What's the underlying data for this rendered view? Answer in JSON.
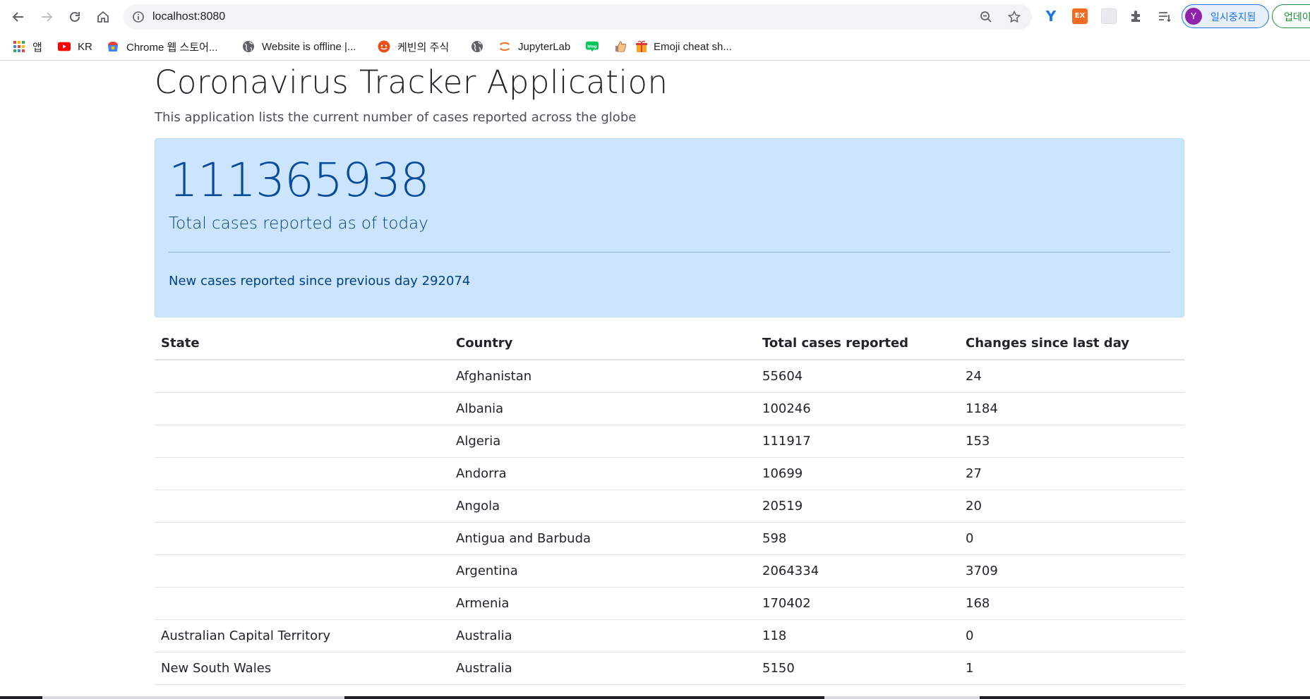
{
  "browser": {
    "url": "localhost:8080",
    "profile_initial": "Y",
    "profile_label": "일시중지됨",
    "update_label": "업데이",
    "extensions": [
      "v-extension-icon",
      "ex-extension-icon",
      "grey-extension-icon",
      "puzzle-icon",
      "reading-list-icon"
    ],
    "bookmarks": [
      {
        "label": "앱",
        "icon": "apps-grid-icon"
      },
      {
        "label": "KR",
        "icon": "youtube-icon"
      },
      {
        "label": "Chrome 웹 스토어...",
        "icon": "chrome-webstore-icon"
      },
      {
        "label": "Website is offline |...",
        "icon": "globe-icon"
      },
      {
        "label": "케빈의 주식",
        "icon": "orange-face-icon"
      },
      {
        "label": "",
        "icon": "globe-icon"
      },
      {
        "label": "JupyterLab",
        "icon": "jupyter-icon"
      },
      {
        "label": "",
        "icon": "blog-icon"
      },
      {
        "label": "",
        "icon": "thumbs-up-icon"
      },
      {
        "label": "Emoji cheat sh...",
        "icon": "gift-icon"
      }
    ]
  },
  "page": {
    "title": "Coronavirus Tracker Application",
    "subtitle": "This application lists the current number of cases reported across the globe",
    "total_cases": "111365938",
    "total_label": "Total cases reported as of today",
    "new_cases_text": "New cases reported since previous day 292074"
  },
  "table": {
    "headers": [
      "State",
      "Country",
      "Total cases reported",
      "Changes since last day"
    ],
    "rows": [
      [
        "",
        "Afghanistan",
        "55604",
        "24"
      ],
      [
        "",
        "Albania",
        "100246",
        "1184"
      ],
      [
        "",
        "Algeria",
        "111917",
        "153"
      ],
      [
        "",
        "Andorra",
        "10699",
        "27"
      ],
      [
        "",
        "Angola",
        "20519",
        "20"
      ],
      [
        "",
        "Antigua and Barbuda",
        "598",
        "0"
      ],
      [
        "",
        "Argentina",
        "2064334",
        "3709"
      ],
      [
        "",
        "Armenia",
        "170402",
        "168"
      ],
      [
        "Australian Capital Territory",
        "Australia",
        "118",
        "0"
      ],
      [
        "New South Wales",
        "Australia",
        "5150",
        "1"
      ]
    ]
  }
}
